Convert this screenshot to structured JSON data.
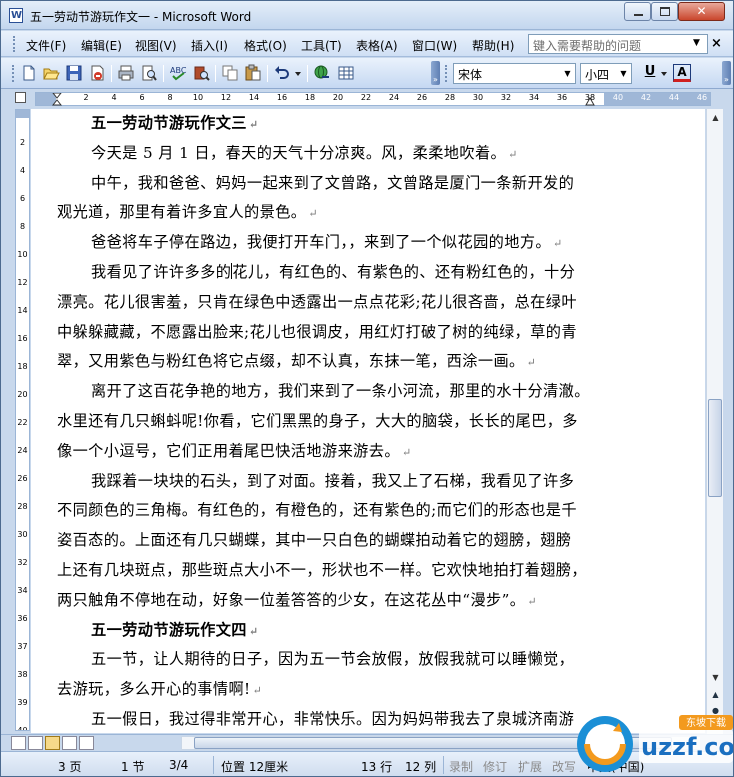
{
  "window": {
    "app_icon": "word-doc-icon",
    "app_icon_letter": "W",
    "title": "五一劳动节游玩作文一 - Microsoft Word",
    "controls": [
      "minimize-icon",
      "maximize-icon",
      "close-icon"
    ],
    "close_glyph": "✕"
  },
  "menubar": {
    "items": [
      "文件(F)",
      "编辑(E)",
      "视图(V)",
      "插入(I)",
      "格式(O)",
      "工具(T)",
      "表格(A)",
      "窗口(W)",
      "帮助(H)"
    ],
    "help_placeholder": "键入需要帮助的问题",
    "doc_close": "×"
  },
  "toolbar": {
    "buttons": [
      "new-icon",
      "open-icon",
      "save-icon",
      "permission-icon",
      "print-icon",
      "print-preview-icon",
      "spelling-icon",
      "research-icon",
      "copy-icon",
      "paste-icon",
      "undo-icon",
      "hyperlink-icon",
      "table-icon"
    ],
    "font_name": "宋体",
    "font_size": "小四",
    "underline": "U",
    "font_color": "A"
  },
  "ruler": {
    "ticks": [
      "2",
      "4",
      "6",
      "8",
      "10",
      "12",
      "14",
      "16",
      "18",
      "20",
      "22",
      "24",
      "26",
      "28",
      "30",
      "32",
      "34",
      "36",
      "38",
      "40",
      "42",
      "44",
      "46"
    ],
    "vertical_ticks": [
      "2",
      "4",
      "6",
      "8",
      "10",
      "12",
      "14",
      "16",
      "18",
      "20",
      "22",
      "24",
      "26",
      "28",
      "30",
      "32",
      "34",
      "36",
      "37",
      "38",
      "39",
      "40"
    ]
  },
  "document": {
    "pilcrow": "↵",
    "lines": [
      {
        "text": "五一劳动节游玩作文三",
        "heading": true,
        "mark": true
      },
      {
        "text": "今天是 5 月 1 日，春天的天气十分凉爽。风，柔柔地吹着。",
        "mark": true
      },
      {
        "text": "中午，我和爸爸、妈妈一起来到了文曾路，文曾路是厦门一条新开发的",
        "mark": false
      },
      {
        "text": "观光道，那里有着许多宜人的景色。",
        "mark": true
      },
      {
        "text": "爸爸将车子停在路边，我便打开车门，，来到了一个似花园的地方。",
        "mark": true
      },
      {
        "text_before": "我看见了许许多多的",
        "text_after": "花儿，有红色的、有紫色的、还有粉红色的，十分",
        "cursor": true,
        "mark": false
      },
      {
        "text": "漂亮。花儿很害羞，只肯在绿色中透露出一点点花彩;花儿很吝啬，总在绿叶",
        "mark": false
      },
      {
        "text": "中躲躲藏藏，不愿露出脸来;花儿也很调皮，用红灯打破了树的纯绿，草的青",
        "mark": false
      },
      {
        "text": "翠，又用紫色与粉红色将它点缀，却不认真，东抹一笔，西涂一画。",
        "mark": true
      },
      {
        "text": "离开了这百花争艳的地方，我们来到了一条小河流，那里的水十分清澈。",
        "mark": false
      },
      {
        "text": "水里还有几只蝌蚪呢!你看，它们黑黑的身子，大大的脑袋，长长的尾巴，多",
        "mark": false
      },
      {
        "text": "像一个小逗号，它们正用着尾巴快活地游来游去。",
        "mark": true
      },
      {
        "text": "我踩着一块块的石头，到了对面。接着，我又上了石梯，我看见了许多",
        "mark": false
      },
      {
        "text": "不同颜色的三角梅。有红色的，有橙色的，还有紫色的;而它们的形态也是千",
        "mark": false
      },
      {
        "text": "姿百态的。上面还有几只蝴蝶，其中一只白色的蝴蝶拍动着它的翅膀，翅膀",
        "mark": false
      },
      {
        "text": "上还有几块斑点，那些斑点大小不一，形状也不一样。它欢快地拍打着翅膀，",
        "mark": false
      },
      {
        "text": "两只触角不停地在动，好象一位羞答答的少女，在这花丛中“漫步”。",
        "mark": true
      },
      {
        "text": "五一劳动节游玩作文四",
        "heading": true,
        "mark": true
      },
      {
        "text": "五一节，让人期待的日子，因为五一节会放假，放假我就可以睡懒觉，",
        "mark": false
      },
      {
        "text": "去游玩，多么开心的事情啊!",
        "mark": true
      },
      {
        "text": "五一假日，我过得非常开心，非常快乐。因为妈妈带我去了泉城济南游",
        "mark": false
      }
    ]
  },
  "scrollbar": {
    "up": "▲",
    "down": "▼",
    "prev": "▲",
    "select": "●",
    "next": "▼"
  },
  "statusbar": {
    "page": "3 页",
    "section": "1 节",
    "page_of": "3/4",
    "position": "位置 12厘米",
    "line": "13 行",
    "column": "12 列",
    "rec": "录制",
    "trk": "修订",
    "ext": "扩展",
    "ovr": "改写",
    "language": "中文(中国)"
  },
  "watermark": {
    "text": "uzzf.com",
    "tag": "东坡下载"
  }
}
